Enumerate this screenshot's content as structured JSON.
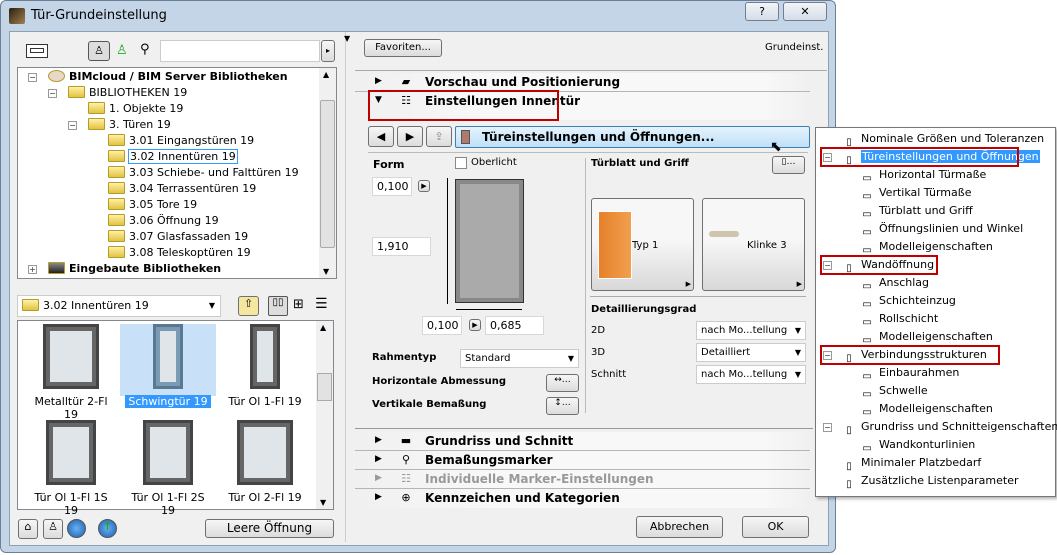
{
  "window": {
    "title": "Tür-Grundeinstellung",
    "help": "?",
    "close": "✕"
  },
  "left": {
    "search_value": "",
    "tree": [
      {
        "label": "BIMcloud / BIM Server Bibliotheken",
        "bold": true,
        "level": 0,
        "toggle": "−",
        "icon": "server"
      },
      {
        "label": "BIBLIOTHEKEN 19",
        "level": 1,
        "toggle": "−",
        "icon": "folder"
      },
      {
        "label": "1. Objekte 19",
        "level": 2,
        "icon": "folder"
      },
      {
        "label": "3. Türen 19",
        "level": 2,
        "toggle": "−",
        "icon": "folder"
      },
      {
        "label": "3.01 Eingangstüren 19",
        "level": 3,
        "icon": "folder"
      },
      {
        "label": "3.02 Innentüren 19",
        "level": 3,
        "icon": "folder",
        "focused": true
      },
      {
        "label": "3.03 Schiebe- und Falttüren 19",
        "level": 3,
        "icon": "folder"
      },
      {
        "label": "3.04 Terrassentüren 19",
        "level": 3,
        "icon": "folder"
      },
      {
        "label": "3.05 Tore 19",
        "level": 3,
        "icon": "folder"
      },
      {
        "label": "3.06 Öffnung 19",
        "level": 3,
        "icon": "folder"
      },
      {
        "label": "3.07 Glasfassaden 19",
        "level": 3,
        "icon": "folder"
      },
      {
        "label": "3.08 Teleskoptüren 19",
        "level": 3,
        "icon": "folder"
      },
      {
        "label": "Eingebaute Bibliotheken",
        "bold": true,
        "level": 0,
        "toggle": "+",
        "icon": "library"
      }
    ],
    "folder_select": "3.02 Innentüren 19",
    "objects": [
      {
        "label": "Metalltür 2-Fl 19",
        "type": "double"
      },
      {
        "label": "Schwingtür 19",
        "type": "single",
        "selected": true
      },
      {
        "label": "Tür Ol 1-Fl 19",
        "type": "single-top"
      },
      {
        "label": "Tür Ol 1-Fl 1S 19",
        "type": "side1"
      },
      {
        "label": "Tür Ol 1-Fl 2S 19",
        "type": "side2"
      },
      {
        "label": "Tür Ol 2-Fl 19",
        "type": "double-top"
      }
    ],
    "empty_opening": "Leere Öffnung"
  },
  "right": {
    "favorites": "Favoriten...",
    "preset": "Grundeinst.",
    "sections_top": [
      {
        "label": "Vorschau und Positionierung",
        "icon": "preview-icon"
      },
      {
        "label": "Einstellungen Innentür",
        "icon": "settings-icon",
        "expanded": true
      }
    ],
    "page_button": "Türeinstellungen und Öffnungen...",
    "form": {
      "label": "Form",
      "oberlicht": "Oberlicht",
      "top_value": "0,100",
      "height_value": "1,910",
      "left_value": "0,100",
      "width_value": "0,685"
    },
    "rahmentyp": {
      "label": "Rahmentyp",
      "value": "Standard"
    },
    "horizontal": "Horizontale Abmessung",
    "vertikal": "Vertikale Bemaßung",
    "leaf": {
      "label": "Türblatt und Griff",
      "typ": "Typ 1",
      "klinke": "Klinke 3"
    },
    "detail": {
      "label": "Detaillierungsgrad",
      "rows": [
        {
          "label": "2D",
          "value": "nach Mo...tellung"
        },
        {
          "label": "3D",
          "value": "Detailliert"
        },
        {
          "label": "Schnitt",
          "value": "nach Mo...tellung"
        }
      ]
    },
    "sections_bottom": [
      {
        "label": "Grundriss und Schnitt",
        "icon": "floorplan-icon"
      },
      {
        "label": "Bemaßungsmarker",
        "icon": "dimension-marker-icon"
      },
      {
        "label": "Individuelle Marker-Einstellungen",
        "icon": "marker-settings-icon",
        "disabled": true
      },
      {
        "label": "Kennzeichen und Kategorien",
        "icon": "categories-icon"
      }
    ],
    "cancel": "Abbrechen",
    "ok": "OK"
  },
  "popup": {
    "items": [
      {
        "label": "Nominale Größen und Toleranzen",
        "level": 0
      },
      {
        "label": "Türeinstellungen und Öffnungen",
        "level": 0,
        "selected": true,
        "boxed": true,
        "toggle": "−"
      },
      {
        "label": "Horizontal Türmaße",
        "level": 1
      },
      {
        "label": "Vertikal Türmaße",
        "level": 1
      },
      {
        "label": "Türblatt und Griff",
        "level": 1
      },
      {
        "label": "Öffnungslinien und Winkel",
        "level": 1
      },
      {
        "label": "Modelleigenschaften",
        "level": 1
      },
      {
        "label": "Wandöffnung",
        "level": 0,
        "boxed": true,
        "toggle": "−"
      },
      {
        "label": "Anschlag",
        "level": 1
      },
      {
        "label": "Schichteinzug",
        "level": 1
      },
      {
        "label": "Rollschicht",
        "level": 1
      },
      {
        "label": "Modelleigenschaften",
        "level": 1
      },
      {
        "label": "Verbindungsstrukturen",
        "level": 0,
        "boxed": true,
        "toggle": "−"
      },
      {
        "label": "Einbaurahmen",
        "level": 1
      },
      {
        "label": "Schwelle",
        "level": 1
      },
      {
        "label": "Modelleigenschaften",
        "level": 1
      },
      {
        "label": "Grundriss und Schnitteigenschaften",
        "level": 0,
        "toggle": "−"
      },
      {
        "label": "Wandkonturlinien",
        "level": 1
      },
      {
        "label": "Minimaler Platzbedarf",
        "level": 0
      },
      {
        "label": "Zusätzliche Listenparameter",
        "level": 0
      }
    ]
  },
  "colors": {
    "selection": "#3399ff",
    "highlight_box": "#c00000",
    "page_button": "#cde8fb"
  }
}
